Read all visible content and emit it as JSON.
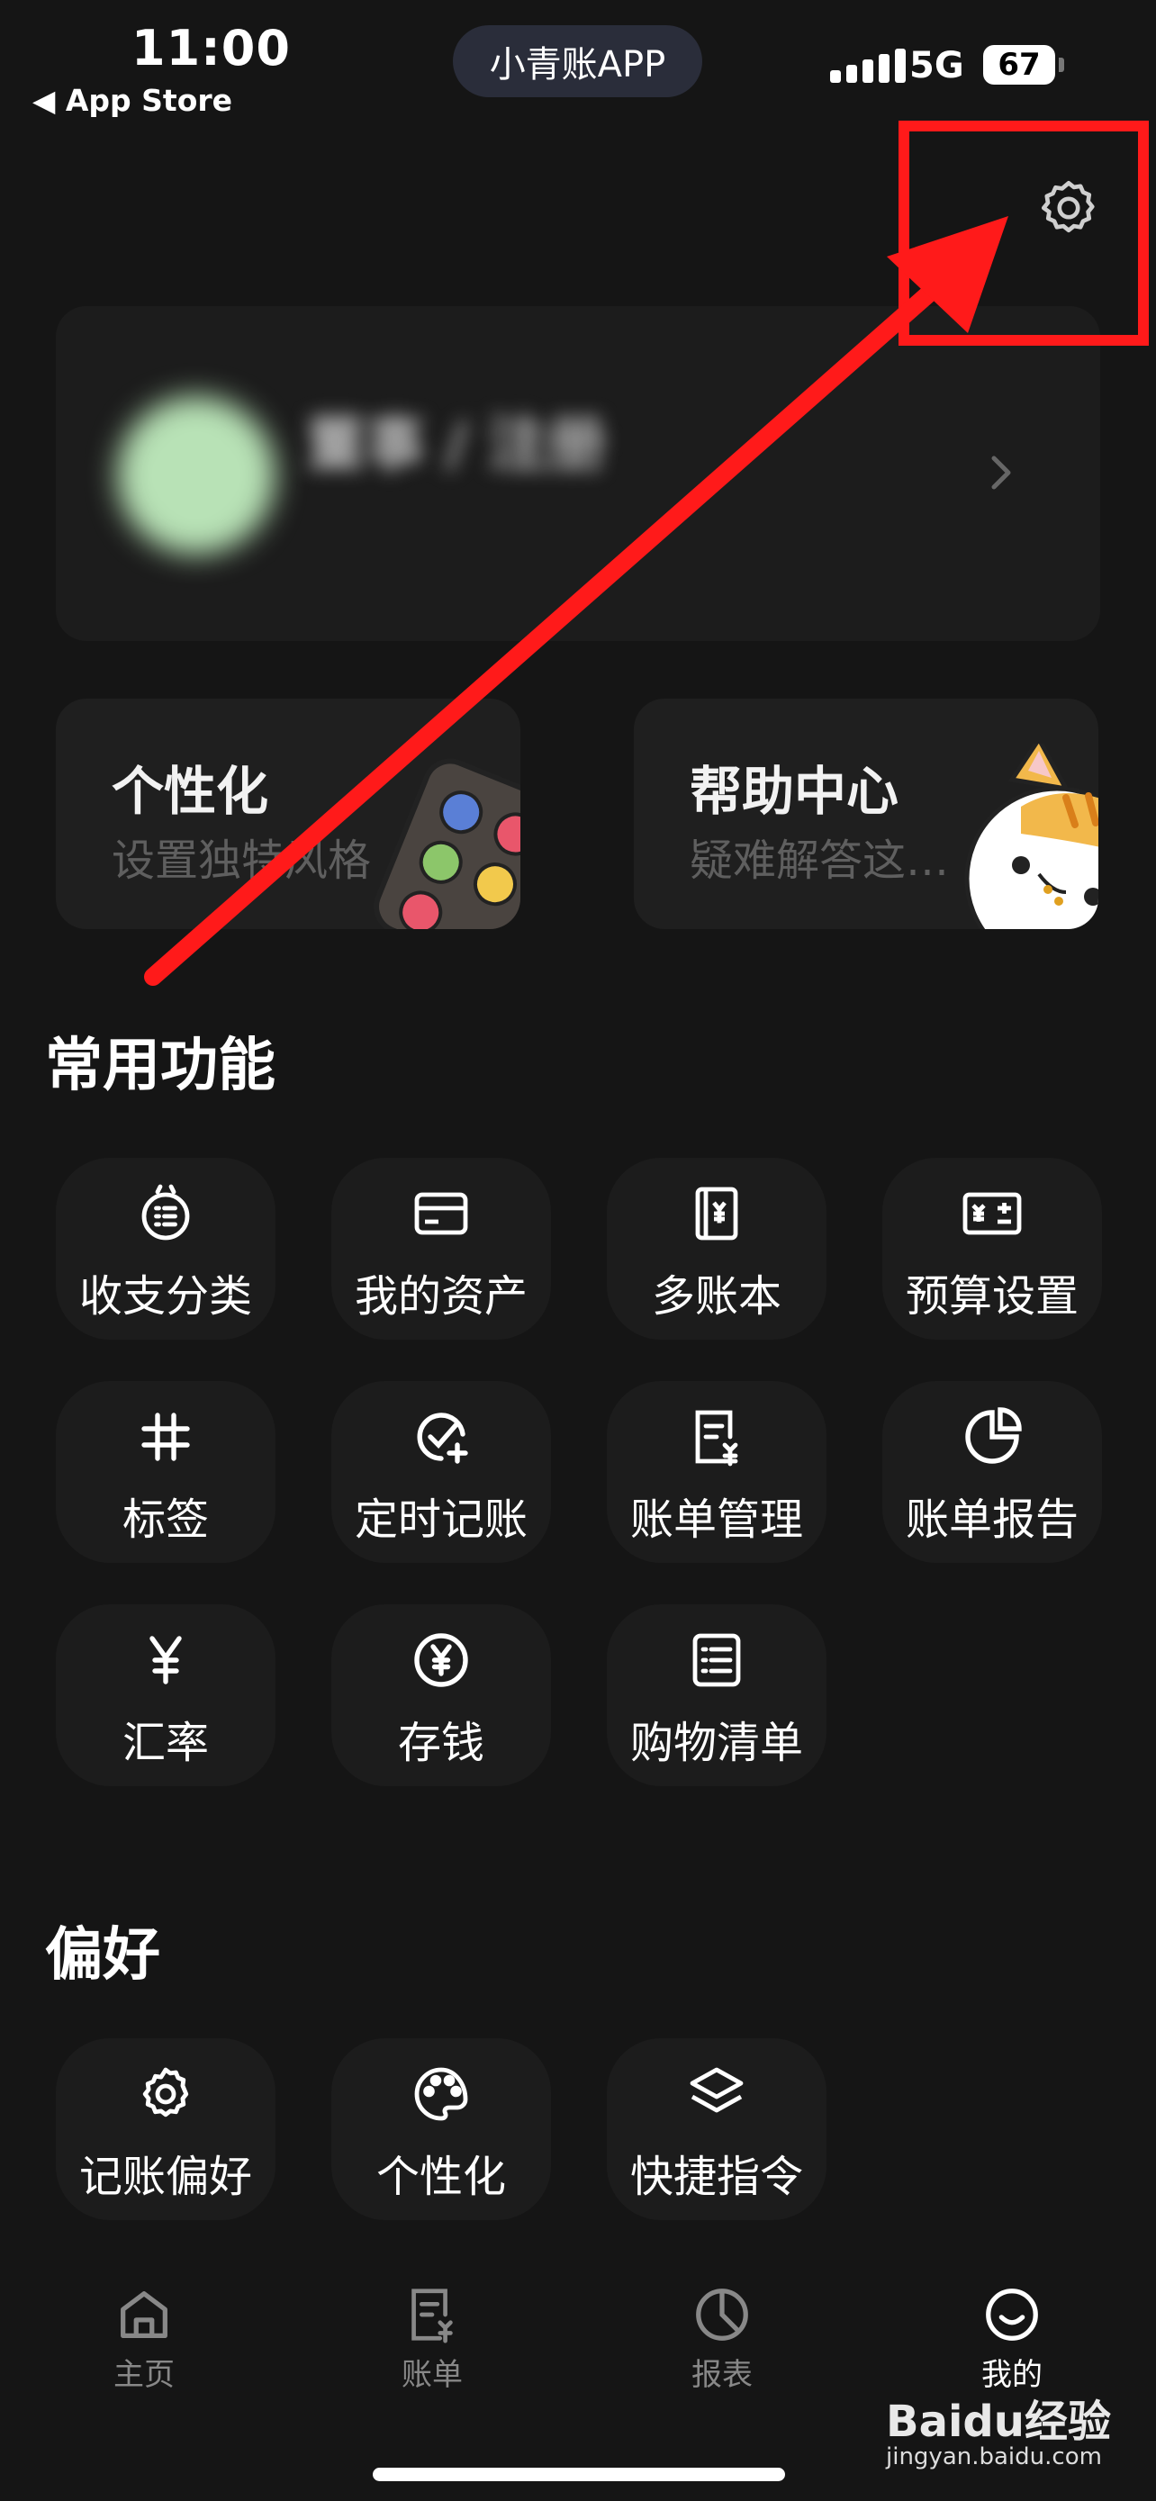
{
  "status_bar": {
    "time": "11:00",
    "back_app": "App Store",
    "island_text": "小青账APP",
    "network": "5G",
    "battery": "67"
  },
  "profile": {
    "name": "董事 / 注册",
    "chevron": "chevron-right-icon"
  },
  "promo_cards": [
    {
      "title": "个性化",
      "subtitle": "设置独特风格",
      "icon": "palette-illustration"
    },
    {
      "title": "帮助中心",
      "subtitle": "疑难解答这…",
      "icon": "cat-illustration"
    }
  ],
  "common": {
    "title": "常用功能",
    "items": [
      {
        "label": "收支分类",
        "icon": "category-icon"
      },
      {
        "label": "我的资产",
        "icon": "card-icon"
      },
      {
        "label": "多账本",
        "icon": "ledger-icon"
      },
      {
        "label": "预算设置",
        "icon": "budget-icon"
      },
      {
        "label": "标签",
        "icon": "hash-icon"
      },
      {
        "label": "定时记账",
        "icon": "timer-check-icon"
      },
      {
        "label": "账单管理",
        "icon": "bill-icon"
      },
      {
        "label": "账单报告",
        "icon": "pie-icon"
      },
      {
        "label": "汇率",
        "icon": "yen-icon"
      },
      {
        "label": "存钱",
        "icon": "coin-icon"
      },
      {
        "label": "购物清单",
        "icon": "list-icon"
      }
    ]
  },
  "prefs": {
    "title": "偏好",
    "items": [
      {
        "label": "记账偏好",
        "icon": "gear-icon"
      },
      {
        "label": "个性化",
        "icon": "palette-icon"
      },
      {
        "label": "快捷指令",
        "icon": "layers-icon"
      }
    ]
  },
  "tabs": [
    {
      "label": "主页",
      "icon": "home-icon"
    },
    {
      "label": "账单",
      "icon": "bill-icon"
    },
    {
      "label": "报表",
      "icon": "chart-icon"
    },
    {
      "label": "我的",
      "icon": "smile-icon"
    }
  ],
  "watermark": {
    "brand": "Baidu经验",
    "url": "jingyan.baidu.com"
  },
  "annotation": {
    "highlight_color": "#ff1a1a"
  }
}
